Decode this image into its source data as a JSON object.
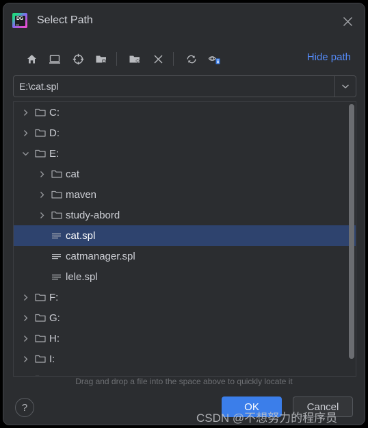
{
  "window": {
    "title": "Select Path",
    "app_icon": "datagrip-icon",
    "icon_letters": "DG",
    "close_icon": "close-icon"
  },
  "toolbar": {
    "buttons": [
      {
        "name": "home-icon",
        "tooltip": "Home"
      },
      {
        "name": "desktop-icon",
        "tooltip": "Desktop"
      },
      {
        "name": "target-icon",
        "tooltip": "Locate"
      },
      {
        "name": "project-folder-icon",
        "tooltip": "Project"
      },
      {
        "name": "new-folder-icon",
        "tooltip": "New Folder"
      },
      {
        "name": "delete-icon",
        "tooltip": "Delete"
      },
      {
        "name": "refresh-icon",
        "tooltip": "Refresh"
      },
      {
        "name": "show-hidden-icon",
        "tooltip": "Show Hidden Files"
      }
    ],
    "hide_path_label": "Hide path"
  },
  "path_field": {
    "value": "E:\\cat.spl",
    "placeholder": "",
    "dropdown_icon": "chevron-down-icon"
  },
  "tree": {
    "rows": [
      {
        "label": "C:",
        "depth": 0,
        "type": "folder",
        "twisty": "collapsed",
        "selected": false
      },
      {
        "label": "D:",
        "depth": 0,
        "type": "folder",
        "twisty": "collapsed",
        "selected": false
      },
      {
        "label": "E:",
        "depth": 0,
        "type": "folder",
        "twisty": "expanded",
        "selected": false
      },
      {
        "label": "cat",
        "depth": 1,
        "type": "folder",
        "twisty": "collapsed",
        "selected": false
      },
      {
        "label": "maven",
        "depth": 1,
        "type": "folder",
        "twisty": "collapsed",
        "selected": false
      },
      {
        "label": "study-abord",
        "depth": 1,
        "type": "folder",
        "twisty": "collapsed",
        "selected": false
      },
      {
        "label": "cat.spl",
        "depth": 1,
        "type": "file",
        "twisty": "none",
        "selected": true
      },
      {
        "label": "catmanager.spl",
        "depth": 1,
        "type": "file",
        "twisty": "none",
        "selected": false
      },
      {
        "label": "lele.spl",
        "depth": 1,
        "type": "file",
        "twisty": "none",
        "selected": false
      },
      {
        "label": "F:",
        "depth": 0,
        "type": "folder",
        "twisty": "collapsed",
        "selected": false
      },
      {
        "label": "G:",
        "depth": 0,
        "type": "folder",
        "twisty": "collapsed",
        "selected": false
      },
      {
        "label": "H:",
        "depth": 0,
        "type": "folder",
        "twisty": "collapsed",
        "selected": false
      },
      {
        "label": "I:",
        "depth": 0,
        "type": "folder",
        "twisty": "collapsed",
        "selected": false
      },
      {
        "label": "",
        "depth": 0,
        "type": "folder",
        "twisty": "collapsed",
        "selected": false
      }
    ]
  },
  "hint": {
    "text": "Drag and drop a file into the space above to quickly locate it"
  },
  "footer": {
    "help_label": "?",
    "ok_label": "OK",
    "cancel_label": "Cancel"
  },
  "watermark": {
    "text": "CSDN @不想努力的程序员"
  },
  "colors": {
    "dialog_bg": "#2B2D30",
    "selection_blue": "#2E436E",
    "accent_blue": "#3B7EEA",
    "link_blue": "#548AF7",
    "text": "#CED0D6"
  }
}
